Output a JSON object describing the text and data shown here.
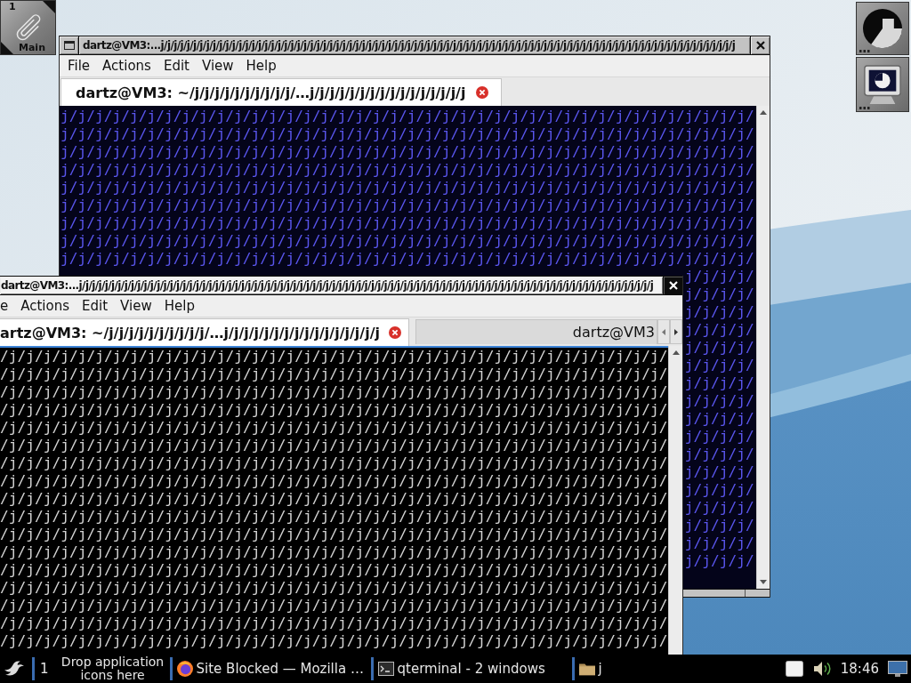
{
  "clip": {
    "workspace_number": "1",
    "workspace_name": "Main"
  },
  "windows": [
    {
      "title": "dartz@VM3:...j/j/j/j/j/j/j/j/j/j/j/j/j/j/j/j/j/j/j/j/j/j/j/j/j/j/j/j/j/j/j/j/j/j/j/j/j/j/j/j/j/j/j/j/j/j/j/j/j/j/j/j/j/j/j/j/j/j/j/j/j/j/j/j/j/j/j/j/j/j/j/j/j/j/j/j/j/j/j/j/j/j/j/j/j/j/j/j/j",
      "active": false,
      "cut_off": false,
      "menu": [
        "File",
        "Actions",
        "Edit",
        "View",
        "Help"
      ],
      "tabs": [
        {
          "label": "dartz@VM3: ~/j/j/j/j/j/j/j/j/j/j/…j/j/j/j/j/j/j/j/j/j/j/j/j/j/j/j",
          "selected": true
        }
      ],
      "tab_scroll_buttons": false,
      "terminal": {
        "lines": [
          "j/j/j/j/j/j/j/j/j/j/j/j/j/j/j/j/j/j/j/j/j/j/j/j/j/j/j/j/j/j/j/j/j/j/j/j/j/j/j/j/",
          "j/j/j/j/j/j/j/j/j/j/j/j/j/j/j/j/j/j/j/j/j/j/j/j/j/j/j/j/j/j/j/j/j/j/j/j/j/j/j/j/",
          "j/j/j/j/j/j/j/j/j/j/j/j/j/j/j/j/j/j/j/j/j/j/j/j/j/j/j/j/j/j/j/j/j/j/j/j/j/j/j/j/",
          "j/j/j/j/j/j/j/j/j/j/j/j/j/j/j/j/j/j/j/j/j/j/j/j/j/j/j/j/j/j/j/j/j/j/j/j/j/j/j/j/",
          "j/j/j/j/j/j/j/j/j/j/j/j/j/j/j/j/j/j/j/j/j/j/j/j/j/j/j/j/j/j/j/j/j/j/j/j/j/j/j/j/",
          "j/j/j/j/j/j/j/j/j/j/j/j/j/j/j/j/j/j/j/j/j/j/j/j/j/j/j/j/j/j/j/j/j/j/j/j/j/j/j/j/",
          "j/j/j/j/j/j/j/j/j/j/j/j/j/j/j/j/j/j/j/j/j/j/j/j/j/j/j/j/j/j/j/j/j/j/j/j/j/j/j/j/",
          "j/j/j/j/j/j/j/j/j/j/j/j/j/j/j/j/j/j/j/j/j/j/j/j/j/j/j/j/j/j/j/j/j/j/j/j/j/j/j/j/",
          "j/j/j/j/j/j/j/j/j/j/j/j/j/j/j/j/j/j/j/j/j/j/j/j/j/j/j/j/j/j/j/j/j/j/j/j/j/j/j/j/",
          "j/j/j/j/",
          "j/j/j/j/",
          "j/j/j/j/",
          "j/j/j/j/",
          "j/j/j/j/",
          "j/j/j/j/",
          "j/j/j/j/",
          "j/j/j/j/",
          "j/j/j/j/",
          "j/j/j/j/",
          "j/j/j/j/",
          "j/j/j/j/",
          "j/j/j/j/",
          "j/j/j/j/",
          "j/j/j/j/",
          "j/j/j/j/",
          "j/j/j/j/"
        ]
      }
    },
    {
      "title": "dartz@VM3:...j/j/j/j/j/j/j/j/j/j/j/j/j/j/j/j/j/j/j/j/j/j/j/j/j/j/j/j/j/j/j/j/j/j/j/j/j/j/j/j/j/j/j/j/j/j/j/j/j/j/j/j/j/j/j/j/j/j/j/j/j/j/j/j/j/j/j/j/j/j/j/j/j/j/j/j/j/j/j/j/j/j/j/j/j/j/j/j/j",
      "active": true,
      "cut_off": true,
      "menu": [
        "e",
        "Actions",
        "Edit",
        "View",
        "Help"
      ],
      "tabs": [
        {
          "label": "artz@VM3: ~/j/j/j/j/j/j/j/j/j/j/…j/j/j/j/j/j/j/j/j/j/j/j/j/j/j/j",
          "selected": true
        },
        {
          "label": "dartz@VM3",
          "selected": false
        }
      ],
      "tab_scroll_buttons": true,
      "terminal": {
        "lines": [
          "/j/j/j/j/j/j/j/j/j/j/j/j/j/j/j/j/j/j/j/j/j/j/j/j/j/j/j/j/j/j/j/j/j/j/j/j/j/j/",
          "/j/j/j/j/j/j/j/j/j/j/j/j/j/j/j/j/j/j/j/j/j/j/j/j/j/j/j/j/j/j/j/j/j/j/j/j/j/j/",
          "/j/j/j/j/j/j/j/j/j/j/j/j/j/j/j/j/j/j/j/j/j/j/j/j/j/j/j/j/j/j/j/j/j/j/j/j/j/j/",
          "/j/j/j/j/j/j/j/j/j/j/j/j/j/j/j/j/j/j/j/j/j/j/j/j/j/j/j/j/j/j/j/j/j/j/j/j/j/j/",
          "/j/j/j/j/j/j/j/j/j/j/j/j/j/j/j/j/j/j/j/j/j/j/j/j/j/j/j/j/j/j/j/j/j/j/j/j/j/j/",
          "/j/j/j/j/j/j/j/j/j/j/j/j/j/j/j/j/j/j/j/j/j/j/j/j/j/j/j/j/j/j/j/j/j/j/j/j/j/j/",
          "/j/j/j/j/j/j/j/j/j/j/j/j/j/j/j/j/j/j/j/j/j/j/j/j/j/j/j/j/j/j/j/j/j/j/j/j/j/j/",
          "/j/j/j/j/j/j/j/j/j/j/j/j/j/j/j/j/j/j/j/j/j/j/j/j/j/j/j/j/j/j/j/j/j/j/j/j/j/j/",
          "/j/j/j/j/j/j/j/j/j/j/j/j/j/j/j/j/j/j/j/j/j/j/j/j/j/j/j/j/j/j/j/j/j/j/j/j/j/j/",
          "/j/j/j/j/j/j/j/j/j/j/j/j/j/j/j/j/j/j/j/j/j/j/j/j/j/j/j/j/j/j/j/j/j/j/j/j/j/j/",
          "/j/j/j/j/j/j/j/j/j/j/j/j/j/j/j/j/j/j/j/j/j/j/j/j/j/j/j/j/j/j/j/j/j/j/j/j/j/j/",
          "/j/j/j/j/j/j/j/j/j/j/j/j/j/j/j/j/j/j/j/j/j/j/j/j/j/j/j/j/j/j/j/j/j/j/j/j/j/j/",
          "/j/j/j/j/j/j/j/j/j/j/j/j/j/j/j/j/j/j/j/j/j/j/j/j/j/j/j/j/j/j/j/j/j/j/j/j/j/j/",
          "/j/j/j/j/j/j/j/j/j/j/j/j/j/j/j/j/j/j/j/j/j/j/j/j/j/j/j/j/j/j/j/j/j/j/j/j/j/j/",
          "/j/j/j/j/j/j/j/j/j/j/j/j/j/j/j/j/j/j/j/j/j/j/j/j/j/j/j/j/j/j/j/j/j/j/j/j/j/j/",
          "/j/j/j/j/j/j/j/j/j/j/j/j/j/j/j/j/j/j/j/j/j/j/j/j/j/j/j/j/j/j/j/j/j/j/j/j/j/j/",
          "/j/j/j/j/j/j/j/j/j/j/j/j/j/j/j/j/j/j/j/j/j/j/j/j/j/j/j/j/j/j/j/j/j/j/j/j/j/j/"
        ]
      }
    }
  ],
  "taskbar": {
    "desktop": "1",
    "quicklaunch_hint": "Drop application icons here",
    "tasks": [
      {
        "kind": "browser",
        "label": "Site Blocked — Mozilla …"
      },
      {
        "kind": "terminal",
        "label": "qterminal - 2 windows"
      },
      {
        "kind": "folder",
        "label": "j"
      }
    ],
    "clock": "18:46"
  }
}
